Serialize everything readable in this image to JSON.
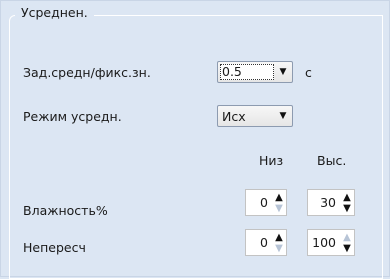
{
  "group": {
    "title": "Усреднен."
  },
  "rows": {
    "setpoint": {
      "label": "Зад.средн/фикс.зн.",
      "value": "0.5",
      "unit": "с",
      "arrow": "▼"
    },
    "mode": {
      "label": "Режим усредн.",
      "value": "Исх",
      "arrow": "▼"
    }
  },
  "columns": {
    "low": "Низ",
    "high": "Выс."
  },
  "limits": [
    {
      "label": "Влажность%",
      "low": {
        "value": "0",
        "up_enabled": true,
        "down_enabled": false
      },
      "high": {
        "value": "30",
        "up_enabled": true,
        "down_enabled": true
      }
    },
    {
      "label": "Непересч",
      "low": {
        "value": "0",
        "up_enabled": true,
        "down_enabled": false
      },
      "high": {
        "value": "100",
        "up_enabled": false,
        "down_enabled": true
      }
    }
  ],
  "icons": {
    "spin_up": "▲",
    "spin_down": "▼"
  },
  "colors": {
    "background": "#dce6f3",
    "field": "#ffffff",
    "disabled_arrow": "#b7c4d6"
  }
}
